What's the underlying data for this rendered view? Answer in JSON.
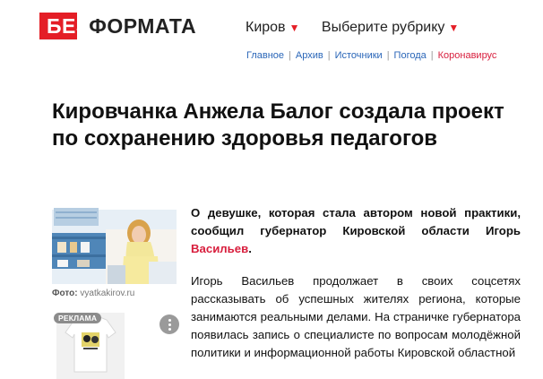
{
  "logo": {
    "part_a": "БЕЗ",
    "part_b": "ФОРМАТА"
  },
  "header": {
    "city_label": "Киров",
    "rubric_label": "Выберите рубрику"
  },
  "sublinks": [
    {
      "label": "Главное"
    },
    {
      "label": "Архив"
    },
    {
      "label": "Источники"
    },
    {
      "label": "Погода"
    },
    {
      "label": "Коронавирус"
    }
  ],
  "article": {
    "title": "Кировчанка Анжела Балог создала проект по сохранению здоровья педагогов",
    "photo_caption_label": "Фото:",
    "photo_caption_source": "vyatkakirov.ru",
    "lead_text": "О девушке, которая стала автором новой практики, сообщил губернатор Кировской области Игорь ",
    "lead_link": "Васильев",
    "lead_end": ".",
    "body_text": "Игорь Васильев продолжает в своих соцсетях рассказывать об успешных жителях региона, которые занимаются реальными делами. На страничке губернатора появилась запись о специалисте по вопросам молодёжной политики и информационной работы Кировской областной"
  },
  "ad": {
    "badge": "РЕКЛАМА"
  },
  "colors": {
    "brand_red": "#e41e26",
    "link_blue": "#2a66b8",
    "accent_red": "#d81e3d"
  }
}
